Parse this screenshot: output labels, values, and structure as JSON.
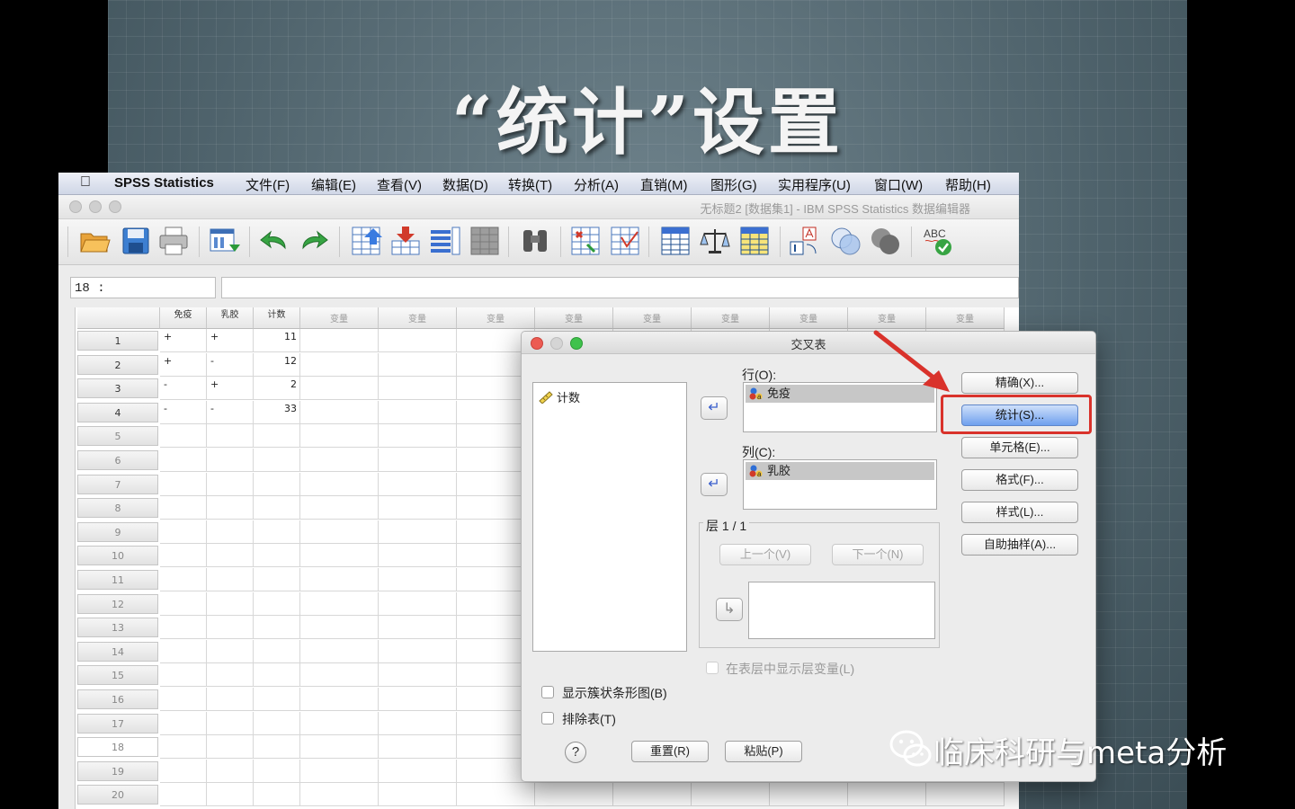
{
  "slide": {
    "title": "“统计”设置"
  },
  "menubar": {
    "app_name": "SPSS Statistics",
    "items": [
      "文件(F)",
      "编辑(E)",
      "查看(V)",
      "数据(D)",
      "转换(T)",
      "分析(A)",
      "直销(M)",
      "图形(G)",
      "实用程序(U)",
      "窗口(W)",
      "帮助(H)"
    ]
  },
  "window": {
    "title": "无标题2 [数据集1] - IBM SPSS Statistics 数据编辑器"
  },
  "toolbar": {
    "buttons": [
      "open-icon",
      "save-icon",
      "print-icon",
      "dialog-recall-icon",
      "undo-icon",
      "redo-icon",
      "goto-case-icon",
      "goto-variable-icon",
      "variables-icon",
      "run-descriptives-icon",
      "find-icon",
      "insert-cases-icon",
      "insert-variable-icon",
      "split-file-icon",
      "weight-cases-icon",
      "select-cases-icon",
      "value-labels-icon",
      "use-sets-icon",
      "show-all-variables-icon",
      "spell-check-icon"
    ]
  },
  "editor": {
    "cell_ref": "18 :",
    "columns": [
      "免疫",
      "乳胶",
      "计数"
    ],
    "empty_column_label": "变量",
    "empty_column_count": 9,
    "rows": [
      {
        "num": "1",
        "a": "+",
        "b": "+",
        "c": "11"
      },
      {
        "num": "2",
        "a": "+",
        "b": "-",
        "c": "12"
      },
      {
        "num": "3",
        "a": "-",
        "b": "+",
        "c": "2"
      },
      {
        "num": "4",
        "a": "-",
        "b": "-",
        "c": "33"
      }
    ],
    "row_numbers": [
      "1",
      "2",
      "3",
      "4",
      "5",
      "6",
      "7",
      "8",
      "9",
      "10",
      "11",
      "12",
      "13",
      "14",
      "15",
      "16",
      "17",
      "18",
      "19",
      "20"
    ]
  },
  "dialog": {
    "title": "交叉表",
    "source_items": [
      "计数"
    ],
    "row_label": "行(O):",
    "row_items": [
      "免疫"
    ],
    "col_label": "列(C):",
    "col_items": [
      "乳胶"
    ],
    "layer_label": "层 1 / 1",
    "prev_label": "上一个(V)",
    "next_label": "下一个(N)",
    "show_layer_label": "在表层中显示层变量(L)",
    "bar_chart_label": "显示簇状条形图(B)",
    "suppress_label": "排除表(T)",
    "help_label": "?",
    "reset_label": "重置(R)",
    "paste_label": "粘贴(P)",
    "side_buttons": [
      "精确(X)...",
      "统计(S)...",
      "单元格(E)...",
      "格式(F)...",
      "样式(L)...",
      "自助抽样(A)..."
    ]
  },
  "watermark": {
    "text": "临床科研与meta分析"
  },
  "colors": {
    "highlight": "#d9322b",
    "accent": "#6fa0ee"
  }
}
